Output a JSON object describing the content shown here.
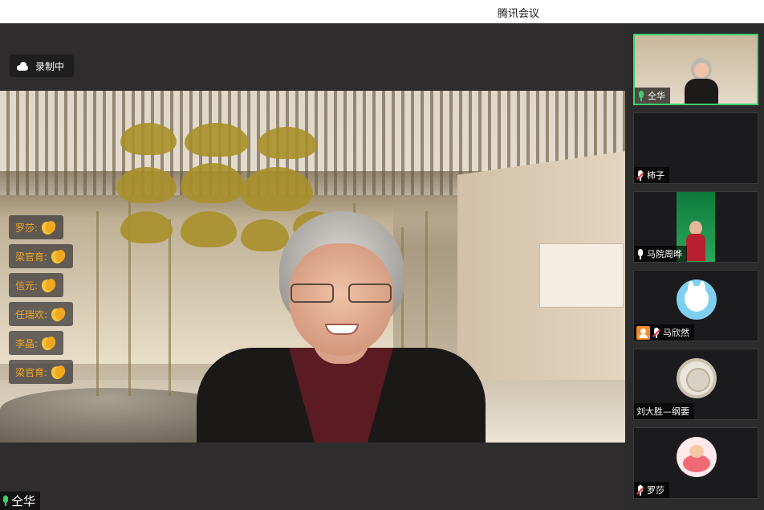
{
  "window": {
    "title": "腾讯会议"
  },
  "recording": {
    "label": "录制中",
    "icon": "cloud-icon"
  },
  "reactions": [
    {
      "name": "罗莎:",
      "icon": "clap-icon"
    },
    {
      "name": "梁官育:",
      "icon": "clap-icon"
    },
    {
      "name": "信元:",
      "icon": "clap-icon"
    },
    {
      "name": "任瑞欢:",
      "icon": "clap-icon"
    },
    {
      "name": "李晶:",
      "icon": "clap-icon"
    },
    {
      "name": "梁官育:",
      "icon": "clap-icon"
    }
  ],
  "speaker": {
    "name": "仝华",
    "mic": "on"
  },
  "participants": [
    {
      "name": "仝华",
      "mic": "on",
      "active": true,
      "kind": "video"
    },
    {
      "name": "柿子",
      "mic": "muted",
      "kind": "blank"
    },
    {
      "name": "马院周晔",
      "mic": "on",
      "kind": "poster"
    },
    {
      "name": "马欣然",
      "mic": "muted",
      "host": true,
      "kind": "avatar-bunny"
    },
    {
      "name": "刘大胜—纲要",
      "mic": "none",
      "kind": "avatar-plate"
    },
    {
      "name": "罗莎",
      "mic": "muted",
      "kind": "avatar-cartoon"
    }
  ],
  "colors": {
    "active_border": "#3bd170",
    "reaction_text": "#f5a623",
    "muted_red": "#e5383b",
    "host_orange": "#f28c28"
  }
}
